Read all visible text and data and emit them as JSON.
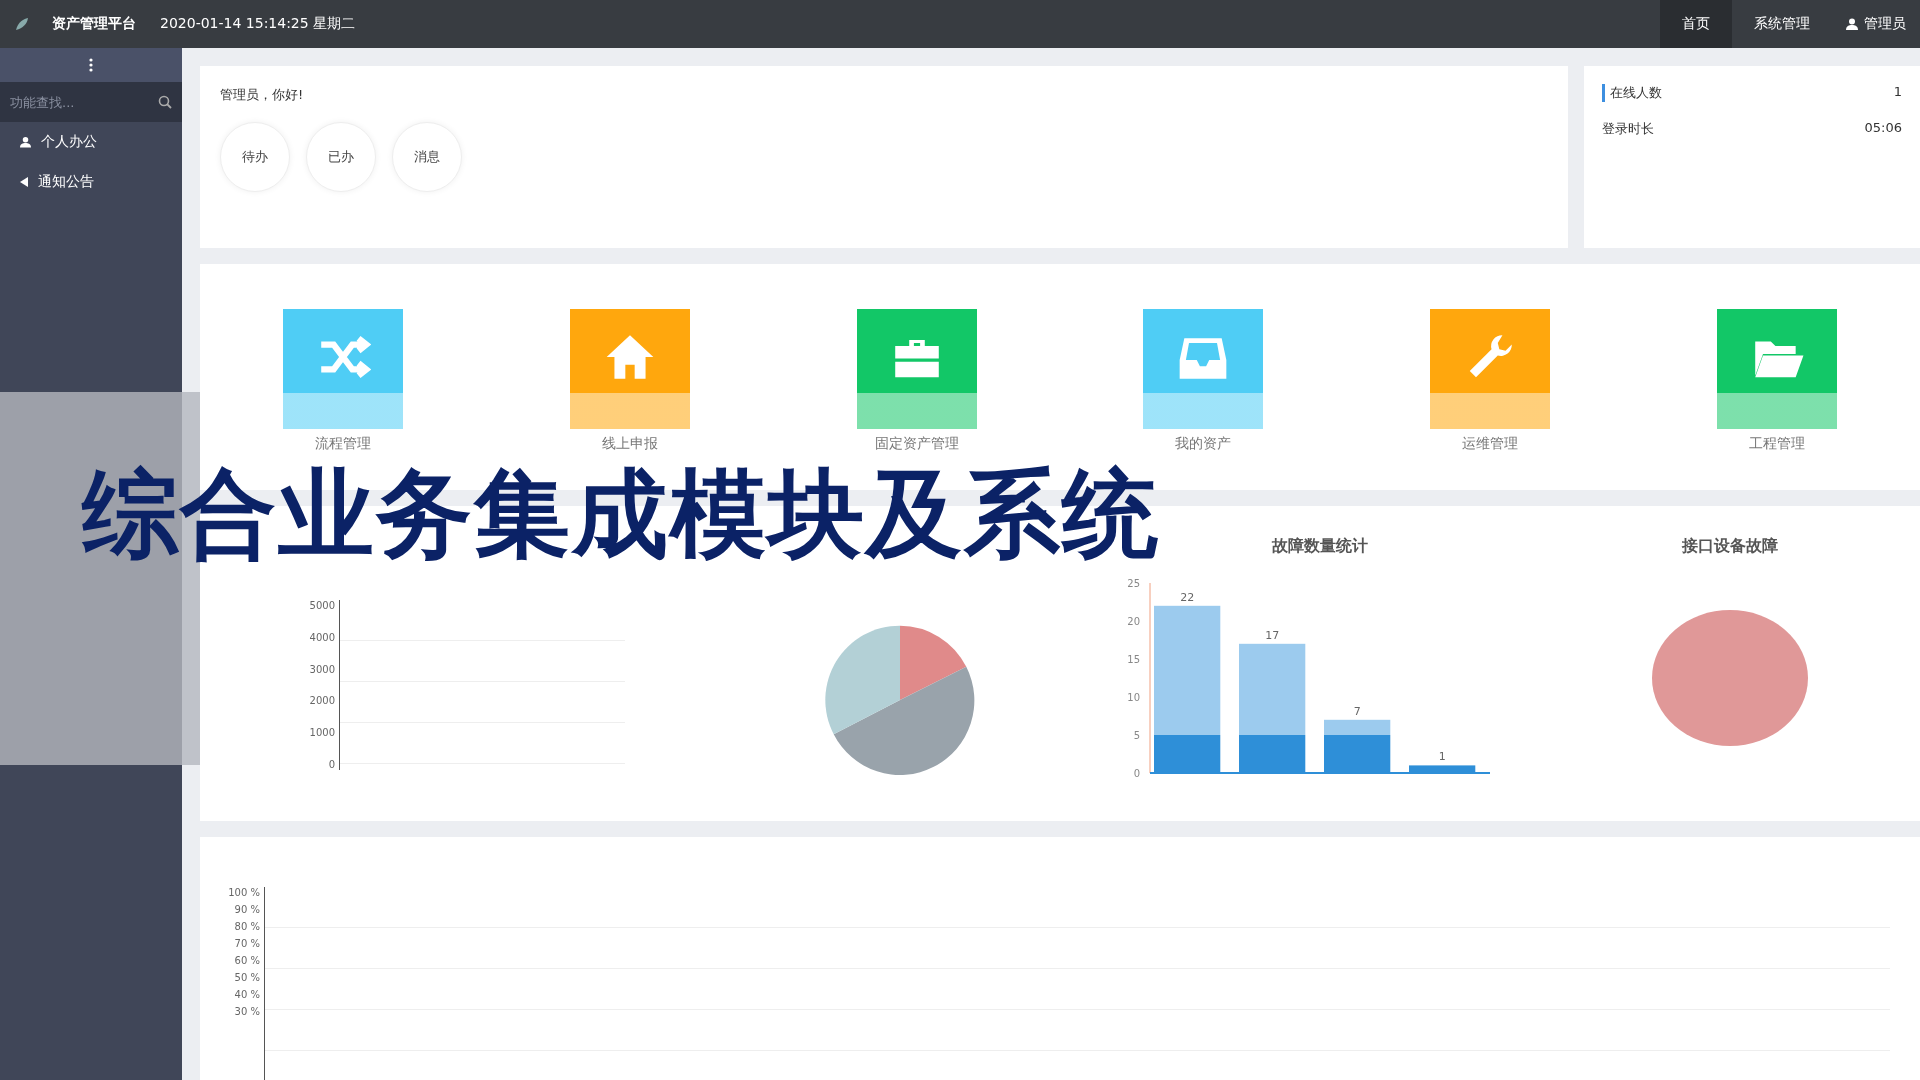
{
  "header": {
    "app_title": "资产管理平台",
    "datetime": "2020-01-14 15:14:25 星期二",
    "nav": [
      {
        "label": "首页",
        "selected": true
      },
      {
        "label": "系统管理",
        "selected": false
      }
    ],
    "user": "管理员"
  },
  "sidebar": {
    "search": {
      "placeholder": "功能查找..."
    },
    "items": [
      {
        "label": "个人办公"
      },
      {
        "label": "通知公告"
      }
    ]
  },
  "welcome": {
    "greeting": "管理员，你好!",
    "shortcuts": [
      "待办",
      "已办",
      "消息"
    ]
  },
  "info": {
    "rows": [
      {
        "label": "在线人数",
        "value": "1",
        "kind": "heading"
      },
      {
        "label": "登录时长",
        "value": "05:06",
        "kind": "plain"
      }
    ]
  },
  "modules": [
    {
      "label": "流程管理",
      "color": "#4fcdf5"
    },
    {
      "label": "线上申报",
      "color": "#ffa70d"
    },
    {
      "label": "固定资产管理",
      "color": "#12c767"
    },
    {
      "label": "我的资产",
      "color": "#4fcdf5"
    },
    {
      "label": "运维管理",
      "color": "#ffa70d"
    },
    {
      "label": "工程管理",
      "color": "#12c767"
    }
  ],
  "charts": {
    "line": {
      "y_labels": [
        "5000",
        "4000",
        "3000",
        "2000",
        "1000",
        "0"
      ]
    },
    "bar": {
      "title": "故障数量统计",
      "totals": [
        "22",
        "17",
        "7",
        "1"
      ],
      "chart_data": {
        "type": "bar",
        "stacked": true,
        "ylim": [
          0,
          25
        ],
        "yticks": [
          0,
          5,
          10,
          15,
          20,
          25
        ],
        "series": [
          {
            "color": "#2e8fd8",
            "values": [
              5,
              5,
              5,
              1
            ]
          },
          {
            "color": "#9ccbee",
            "values": [
              17,
              12,
              2,
              0
            ]
          }
        ]
      }
    },
    "device_pie": {
      "title": "接口设备故障"
    }
  },
  "rate_chart": {
    "y_labels": [
      "100 %",
      "90 %",
      "80 %",
      "70 %",
      "60 %",
      "50 %",
      "40 %",
      "30 %"
    ]
  },
  "overlay_title": "综合业务集成模块及系统"
}
